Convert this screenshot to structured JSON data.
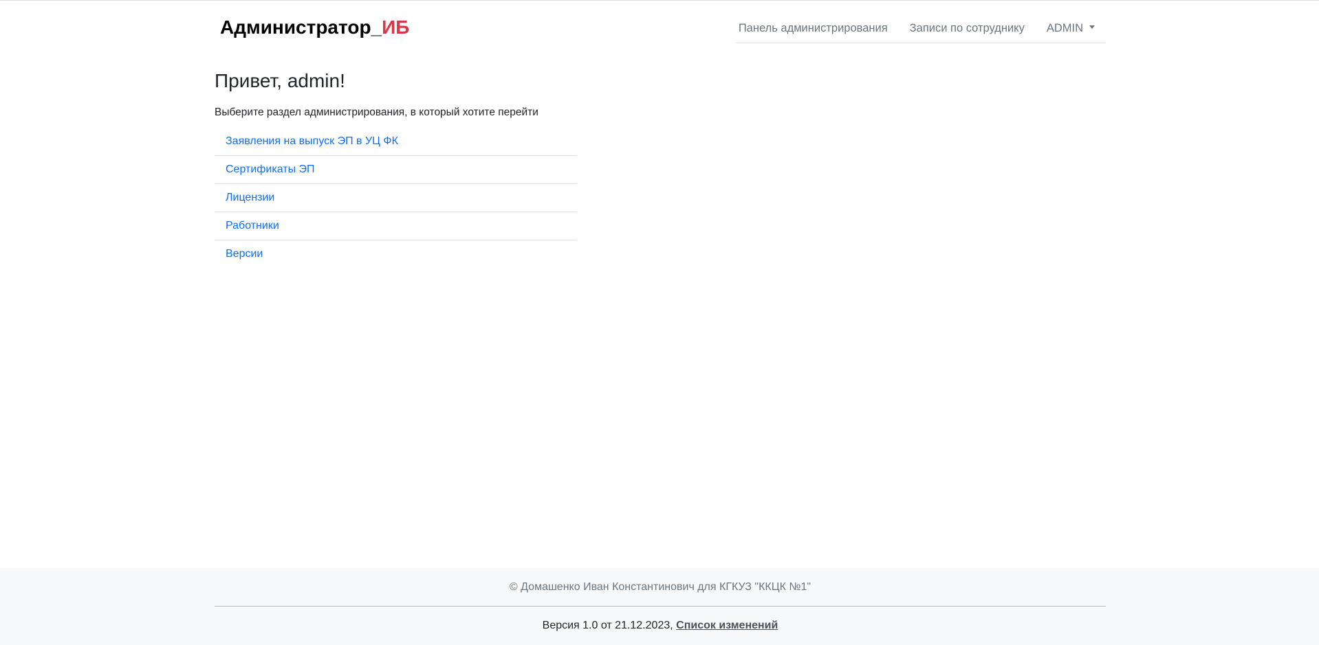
{
  "header": {
    "brand_main": "Администратор_",
    "brand_accent": "ИБ",
    "nav": {
      "admin_panel": "Панель администрирования",
      "employee_records": "Записи по сотруднику",
      "user_menu": "ADMIN"
    }
  },
  "main": {
    "greeting": "Привет, admin!",
    "subtitle": "Выберите раздел администрирования, в который хотите перейти",
    "sections": [
      {
        "label": "Заявления на выпуск ЭП в УЦ ФК"
      },
      {
        "label": "Сертификаты ЭП"
      },
      {
        "label": "Лицензии"
      },
      {
        "label": "Работники"
      },
      {
        "label": "Версии"
      }
    ]
  },
  "footer": {
    "copyright": "© Домашенко Иван Константинович для КГКУЗ \"ККЦК №1\"",
    "version_text": "Версия 1.0 от 21.12.2023, ",
    "changelog_link": "Список изменений"
  },
  "colors": {
    "accent": "#dc3545",
    "link": "#0d6efd",
    "footer_bg": "#f8f9fa"
  },
  "icons": {
    "user_menu_caret": "caret-down-icon"
  }
}
